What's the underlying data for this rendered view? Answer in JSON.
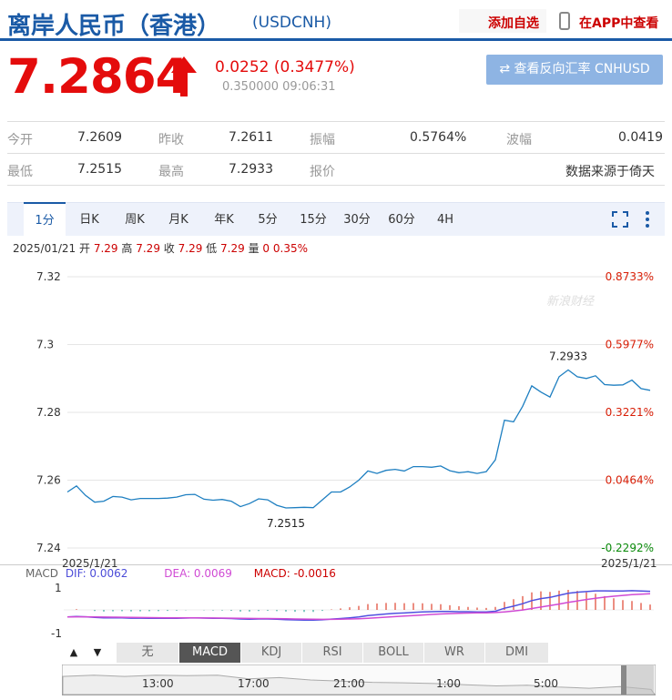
{
  "header": {
    "title": "离岸人民币（香港）",
    "code": "(USDCNH)",
    "add_favorite": "添加自选",
    "view_in_app": "在APP中查看"
  },
  "quote": {
    "price": "7.2864",
    "change": "0.0252 (0.3477%)",
    "subline": "0.350000 09:06:31",
    "reverse_button": "⇄ 查看反向汇率 CNHUSD",
    "rows": [
      [
        {
          "label": "今开",
          "value": "7.2609"
        },
        {
          "label": "昨收",
          "value": "7.2611"
        },
        {
          "label": "振幅",
          "value": "0.5764%"
        },
        {
          "label": "波幅",
          "value": "0.0419"
        }
      ],
      [
        {
          "label": "最低",
          "value": "7.2515"
        },
        {
          "label": "最高",
          "value": "7.2933"
        },
        {
          "label": "报价",
          "value": ""
        },
        {
          "label": "",
          "value": "数据来源于倚天"
        }
      ]
    ]
  },
  "tabs": [
    "1分",
    "日K",
    "周K",
    "月K",
    "年K",
    "5分",
    "15分",
    "30分",
    "60分",
    "4H"
  ],
  "ohlc": {
    "date": "2025/01/21",
    "open_label": "开",
    "open": "7.29",
    "high_label": "高",
    "high": "7.29",
    "close_label": "收",
    "close": "7.29",
    "low_label": "低",
    "low": "7.29",
    "vol_label": "量",
    "vol": "0",
    "pct": "0.35%"
  },
  "watermark": "新浪财经",
  "macd": {
    "title": "MACD",
    "dif": "DIF: 0.0062",
    "dea": "DEA: 0.0069",
    "macd": "MACD: -0.0016",
    "ticks": [
      "1",
      "-1"
    ],
    "date_left": "2025/1/21",
    "date_right": "2025/1/21"
  },
  "indicators": [
    "无",
    "MACD",
    "KDJ",
    "RSI",
    "BOLL",
    "WR",
    "DMI"
  ],
  "nav": {
    "up": "▲",
    "down": "▼"
  },
  "timeline": [
    "13:00",
    "17:00",
    "21:00",
    "1:00",
    "5:00"
  ],
  "chart_data": {
    "type": "line",
    "title": "",
    "xlabel": "",
    "ylabel": "",
    "ylim": [
      7.24,
      7.32
    ],
    "y_ticks": [
      "7.32",
      "7.3",
      "7.28",
      "7.26",
      "7.24"
    ],
    "pct_ticks": [
      "0.8733%",
      "0.5977%",
      "0.3221%",
      "0.0464%",
      "-0.2292%"
    ],
    "grid": true,
    "series": [
      {
        "values": [
          7.2565,
          7.2583,
          7.2555,
          7.2535,
          7.2538,
          7.2552,
          7.255,
          7.2542,
          7.2546,
          7.2546,
          7.2546,
          7.2547,
          7.255,
          7.2557,
          7.2558,
          7.2544,
          7.2541,
          7.2543,
          7.2538,
          7.2522,
          7.2531,
          7.2545,
          7.2542,
          7.2526,
          7.2518,
          7.2519,
          7.252,
          7.2519,
          7.2542,
          7.2565,
          7.2565,
          7.258,
          7.26,
          7.2627,
          7.262,
          7.2629,
          7.2632,
          7.2627,
          7.264,
          7.264,
          7.2638,
          7.2642,
          7.2628,
          7.2622,
          7.2625,
          7.262,
          7.2625,
          7.266,
          7.2777,
          7.2772,
          7.2818,
          7.2878,
          7.286,
          7.2845,
          7.2905,
          7.2925,
          7.2905,
          7.29,
          7.2908,
          7.2882,
          7.288,
          7.2881,
          7.2895,
          7.287,
          7.2865
        ]
      }
    ],
    "annotations": [
      {
        "label": "7.2933",
        "x_index": 55,
        "value": 7.2933
      },
      {
        "label": "7.2515",
        "x_index": 24,
        "value": 7.2515
      }
    ]
  }
}
